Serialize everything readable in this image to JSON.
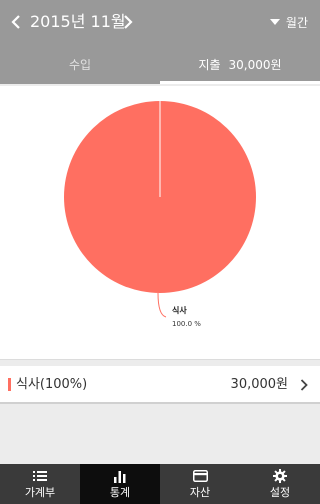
{
  "header": {
    "month": "2015년 11월",
    "period": "월간",
    "prev_icon": "chevron-left-icon",
    "next_icon": "chevron-right-icon",
    "period_icon": "caret-down-icon"
  },
  "tabs": [
    {
      "label": "수입",
      "amount": ""
    },
    {
      "label": "지출",
      "amount": "30,000원",
      "active": true
    }
  ],
  "chart_data": {
    "type": "pie",
    "slices": [
      {
        "label": "식사",
        "value": 100.0,
        "percent_text": "100.0 %",
        "color": "#ff6f61"
      }
    ]
  },
  "summary": {
    "label": "식사(100%)",
    "amount": "30,000원",
    "color": "#ff6f61"
  },
  "bottom_nav": [
    {
      "label": "가계부",
      "icon": "list-icon"
    },
    {
      "label": "통계",
      "icon": "bar-chart-icon",
      "active": true
    },
    {
      "label": "자산",
      "icon": "card-icon"
    },
    {
      "label": "설정",
      "icon": "gear-icon"
    }
  ],
  "colors": {
    "header_bg": "#999999",
    "slice": "#ff6f61",
    "bottom_nav_bg": "#3a3a3a",
    "bottom_nav_active": "#0d0d0d"
  }
}
